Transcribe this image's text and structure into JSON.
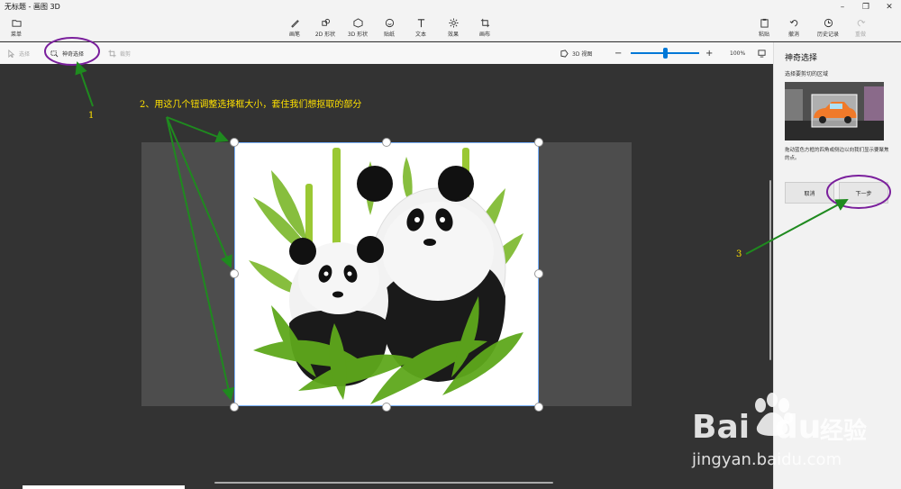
{
  "window": {
    "title": "无标题 - 画图 3D",
    "controls": [
      "minimize",
      "maximize",
      "close"
    ]
  },
  "toolbar": {
    "menu_label": "菜单",
    "tools": [
      {
        "label": "画笔",
        "icon": "brush-icon"
      },
      {
        "label": "2D 形状",
        "icon": "2d-shapes-icon"
      },
      {
        "label": "3D 形状",
        "icon": "3d-shapes-icon"
      },
      {
        "label": "贴纸",
        "icon": "sticker-icon"
      },
      {
        "label": "文本",
        "icon": "text-icon"
      },
      {
        "label": "效果",
        "icon": "effects-icon"
      },
      {
        "label": "画布",
        "icon": "canvas-icon"
      }
    ],
    "right_tools": [
      {
        "label": "粘贴",
        "icon": "paste-icon"
      },
      {
        "label": "撤消",
        "icon": "undo-icon"
      },
      {
        "label": "历史记录",
        "icon": "history-icon"
      },
      {
        "label": "重做",
        "icon": "redo-icon"
      }
    ]
  },
  "subbar": {
    "select_label": "选择",
    "magic_select_label": "神奇选择",
    "crop_label": "裁剪",
    "view3d_label": "3D 视图",
    "zoom_level": "100%",
    "zoom_value": 0.5
  },
  "panel": {
    "title": "神奇选择",
    "subtitle": "选择要剪切的区域",
    "description": "拖动蓝色方框的四角或侧边以向我们显示要聚焦的点。",
    "cancel_label": "取消",
    "next_label": "下一步"
  },
  "annotations": {
    "step1": "1",
    "step2": "2、用这几个钮调整选择框大小，套住我们想抠取的部分",
    "step3": "3",
    "color": "#ffe100",
    "arrow_color": "#1f8a1f",
    "circle_color": "#7a1f9c"
  },
  "watermark": {
    "brand": "Bai",
    "brand2": "du",
    "cn": "经验",
    "url": "jingyan.baidu.com"
  },
  "colors": {
    "accent": "#0078d7",
    "selection": "#7ab2ff"
  }
}
